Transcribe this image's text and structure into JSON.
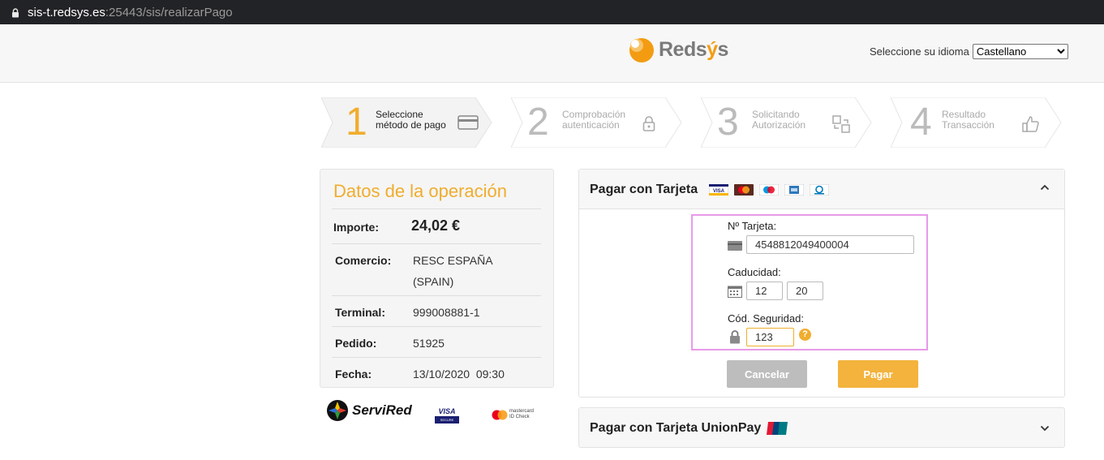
{
  "browser": {
    "host": "sis-t.redsys.es",
    "path": ":25443/sis/realizarPago"
  },
  "header": {
    "logo_text": "Redsys",
    "lang_label": "Seleccione su idioma",
    "lang_selected": "Castellano"
  },
  "steps": [
    {
      "number": "1",
      "line1": "Seleccione",
      "line2": "método de pago",
      "icon": "credit-card-icon",
      "active": true
    },
    {
      "number": "2",
      "line1": "Comprobación",
      "line2": "autenticación",
      "icon": "lock-icon",
      "active": false
    },
    {
      "number": "3",
      "line1": "Solicitando",
      "line2": "Autorización",
      "icon": "transfer-icon",
      "active": false
    },
    {
      "number": "4",
      "line1": "Resultado",
      "line2": "Transacción",
      "icon": "thumbs-up-icon",
      "active": false
    }
  ],
  "operation": {
    "title": "Datos de la operación",
    "rows": [
      {
        "key": "Importe:",
        "value": "24,02 €"
      },
      {
        "key": "Comercio:",
        "value": "RESC ESPAÑA",
        "value2": "(SPAIN)"
      },
      {
        "key": "Terminal:",
        "value": "999008881-1"
      },
      {
        "key": "Pedido:",
        "value": "51925"
      },
      {
        "key": "Fecha:",
        "value": "13/10/2020  09:30"
      }
    ]
  },
  "brands": {
    "servired": "ServiRed",
    "visa": "VISA",
    "visa_sub": "SECURE",
    "mc_line1": "mastercard",
    "mc_line2": "ID Check"
  },
  "payment": {
    "title": "Pagar con Tarjeta",
    "card_label": "Nº Tarjeta:",
    "card_number": "4548812049400004",
    "expiry_label": "Caducidad:",
    "expiry_month": "12",
    "expiry_year": "20",
    "cvv_label": "Cód. Seguridad:",
    "cvv": "123",
    "help_glyph": "?",
    "cancel_label": "Cancelar",
    "pay_label": "Pagar",
    "card_logos": {
      "visa": "VISA"
    }
  },
  "unionpay": {
    "title": "Pagar con Tarjeta UnionPay"
  },
  "colors": {
    "accent": "#f0ad2e",
    "brand_orange": "#f39c12",
    "cancel": "#bdbdbd",
    "pay": "#f3b33d",
    "highlight": "#e89ae8"
  }
}
